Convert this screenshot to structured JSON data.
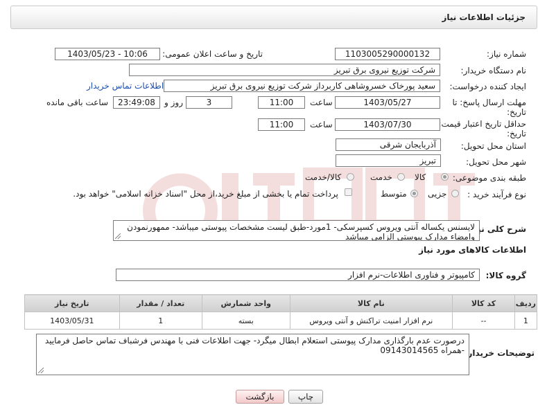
{
  "header": {
    "title": "جزئیات اطلاعات نیاز"
  },
  "form": {
    "need_number": {
      "label": "شماره نیاز:",
      "value": "1103005290000132"
    },
    "announce_datetime": {
      "label": "تاریخ و ساعت اعلان عمومی:",
      "value": "1403/05/23 - 10:06"
    },
    "buyer_org": {
      "label": "نام دستگاه خریدار:",
      "value": "شرکت توزیع نیروی برق تبریز"
    },
    "requester": {
      "label": "ایجاد کننده درخواست:",
      "value": "سعید پورخاک خسروشاهی کاربرداز شرکت توزیع نیروی برق تبریز",
      "contact_link": "اطلاعات تماس خریدار"
    },
    "reply_deadline": {
      "label_line1": "مهلت ارسال پاسخ: تا",
      "label_line2": "تاریخ:",
      "date": "1403/05/27",
      "time_label": "ساعت",
      "time": "11:00",
      "days": "3",
      "days_label": "روز و",
      "remaining": "23:49:08",
      "remaining_label": "ساعت باقی مانده"
    },
    "price_validity": {
      "label_line1": "حداقل تاریخ اعتبار قیمت: تا",
      "label_line2": "تاریخ:",
      "date": "1403/07/30",
      "time_label": "ساعت",
      "time": "11:00"
    },
    "delivery_province": {
      "label": "استان محل تحویل:",
      "value": "آذربایجان شرقی"
    },
    "delivery_city": {
      "label": "شهر محل تحویل:",
      "value": "تبریز"
    },
    "category": {
      "label": "طبقه بندی موضوعی:",
      "options": [
        "کالا",
        "خدمت",
        "کالا/خدمت"
      ],
      "selected": "کالا"
    },
    "purchase_type": {
      "label": "نوع فرآیند خرید :",
      "options": [
        "جزیی",
        "متوسط"
      ],
      "selected": "متوسط",
      "treasury_note": "پرداخت تمام یا بخشی از مبلغ خرید،از محل \"اسناد خزانه اسلامی\" خواهد بود."
    }
  },
  "description": {
    "label": "شرح کلی نیاز:",
    "text": "لایسنس یکساله آنتی ویروس کسپرسکی-  1مورد-طبق لیست مشخصات پیوستی میباشد- ممهورنمودن وامضاء مدارک پیوستی الزامی میباشد"
  },
  "goods_section": {
    "title": "اطلاعات کالاهای مورد نیاز",
    "group_label": "گروه کالا:",
    "group_value": "کامپیوتر و فناوری اطلاعات-نرم افزار"
  },
  "table": {
    "headers": [
      "ردیف",
      "کد کالا",
      "نام کالا",
      "واحد شمارش",
      "تعداد / مقدار",
      "تاریخ نیاز"
    ],
    "rows": [
      [
        "1",
        "--",
        "نرم افزار امنیت تراکنش و آنتی ویروس",
        "بسته",
        "1",
        "1403/05/31"
      ]
    ]
  },
  "buyer_notes": {
    "label": "توضیحات خریدار:",
    "text": "درصورت عدم بارگذاری مدارک پیوستی استعلام ابطال میگرد- جهت اطلاعات فنی با مهندس فرشباف تماس حاصل فرمایید -همراه 09143014565"
  },
  "buttons": {
    "print": "چاپ",
    "back": "بازگشت"
  },
  "colors": {
    "link": "#1a4fb3",
    "back_button": "#f3c9c9"
  }
}
